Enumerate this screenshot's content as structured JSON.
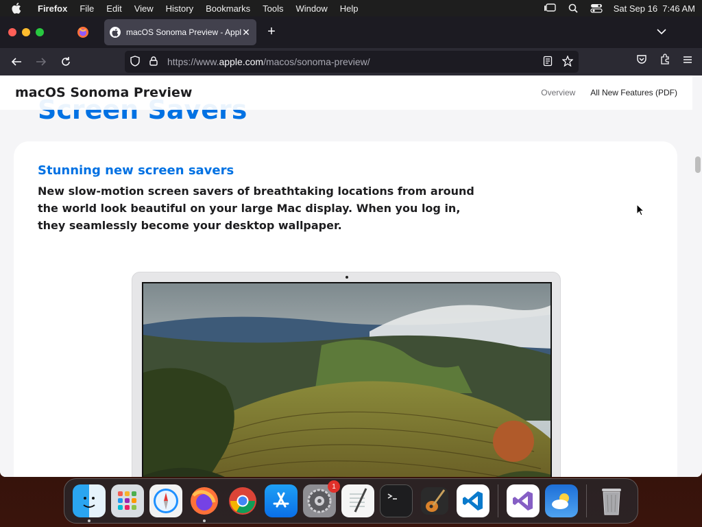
{
  "menubar": {
    "app": "Firefox",
    "items": [
      "File",
      "Edit",
      "View",
      "History",
      "Bookmarks",
      "Tools",
      "Window",
      "Help"
    ],
    "clock": "Sat Sep 16  7:46 AM"
  },
  "browser": {
    "tab_title": "macOS Sonoma Preview - Apple",
    "url_prefix": "https://www.",
    "url_domain": "apple.com",
    "url_path": "/macos/sonoma-preview/"
  },
  "page": {
    "brand": "macOS Sonoma Preview",
    "nav_current": "Overview",
    "nav_link": "All New Features (PDF)",
    "section_heading": "Screen Savers",
    "eyebrow": "Stunning new screen savers",
    "body": "New slow-motion screen savers of breathtaking locations from around the world look beautiful on your large Mac display. When you log in, they seamlessly become your desktop wallpaper."
  },
  "dock": {
    "items": [
      "finder-icon",
      "launchpad-icon",
      "safari-icon",
      "firefox-icon",
      "chrome-icon",
      "app-store-icon",
      "system-settings-icon",
      "textedit-icon",
      "terminal-icon",
      "garageband-icon",
      "vscode-icon",
      "visual-studio-icon",
      "weather-icon",
      "trash-icon"
    ],
    "settings_badge": "1"
  },
  "colors": {
    "accent": "#0071e3",
    "tab_bg": "#42414d",
    "toolbar": "#2b2a33"
  }
}
